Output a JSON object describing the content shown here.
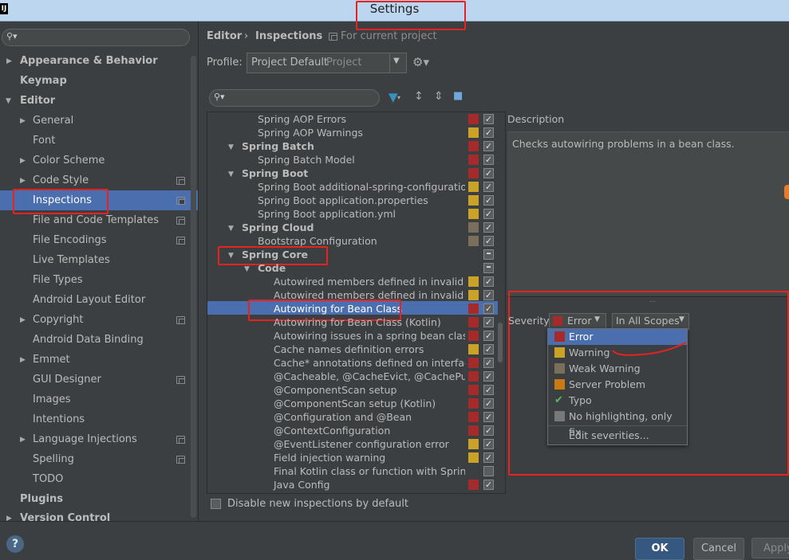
{
  "window": {
    "title": "Settings",
    "logo_text": "IJ"
  },
  "colors": {
    "error": "#a52a2a",
    "warning": "#c9a227",
    "weak_warning": "#7a6f5a",
    "server_problem": "#c87a14",
    "no_highlight": "#787878",
    "selection": "#4b6eaf",
    "annotation": "#e8221e"
  },
  "left_tree": {
    "items": [
      {
        "label": "Appearance & Behavior"
      },
      {
        "label": "Keymap"
      },
      {
        "label": "Editor"
      },
      {
        "label": "General"
      },
      {
        "label": "Font"
      },
      {
        "label": "Color Scheme"
      },
      {
        "label": "Code Style"
      },
      {
        "label": "Inspections"
      },
      {
        "label": "File and Code Templates"
      },
      {
        "label": "File Encodings"
      },
      {
        "label": "Live Templates"
      },
      {
        "label": "File Types"
      },
      {
        "label": "Android Layout Editor"
      },
      {
        "label": "Copyright"
      },
      {
        "label": "Android Data Binding"
      },
      {
        "label": "Emmet"
      },
      {
        "label": "GUI Designer"
      },
      {
        "label": "Images"
      },
      {
        "label": "Intentions"
      },
      {
        "label": "Language Injections"
      },
      {
        "label": "Spelling"
      },
      {
        "label": "TODO"
      },
      {
        "label": "Plugins"
      },
      {
        "label": "Version Control"
      }
    ]
  },
  "header": {
    "breadcrumb_editor": "Editor",
    "breadcrumb_sep": "›",
    "breadcrumb_inspections": "Inspections",
    "scope_note": "For current project",
    "profile_label": "Profile:",
    "profile_value": "Project Default",
    "profile_hint": "Project"
  },
  "inspections": {
    "rows": [
      {
        "label": "Spring AOP Errors"
      },
      {
        "label": "Spring AOP Warnings"
      },
      {
        "label": "Spring Batch"
      },
      {
        "label": "Spring Batch Model"
      },
      {
        "label": "Spring Boot"
      },
      {
        "label": "Spring Boot additional-spring-configuration-"
      },
      {
        "label": "Spring Boot application.properties"
      },
      {
        "label": "Spring Boot application.yml"
      },
      {
        "label": "Spring Cloud"
      },
      {
        "label": "Bootstrap Configuration"
      },
      {
        "label": "Spring Core"
      },
      {
        "label": "Code"
      },
      {
        "label": "Autowired members defined in invalid Sp"
      },
      {
        "label": "Autowired members defined in invalid Sp"
      },
      {
        "label": "Autowiring for Bean Class"
      },
      {
        "label": "Autowiring for Bean Class (Kotlin)"
      },
      {
        "label": "Autowiring issues in a spring bean class c"
      },
      {
        "label": "Cache names definition errors"
      },
      {
        "label": "Cache* annotations defined on interfaces,"
      },
      {
        "label": "@Cacheable, @CacheEvict, @CachePut, @"
      },
      {
        "label": "@ComponentScan setup"
      },
      {
        "label": "@ComponentScan setup (Kotlin)"
      },
      {
        "label": "@Configuration and @Bean"
      },
      {
        "label": "@ContextConfiguration"
      },
      {
        "label": "@EventListener configuration error"
      },
      {
        "label": "Field injection warning"
      },
      {
        "label": "Final Kotlin class or function with Spring a"
      },
      {
        "label": "Java Config"
      }
    ],
    "disable_new_label": "Disable new inspections by default"
  },
  "description": {
    "heading": "Description",
    "text": "Checks autowiring problems in a bean class."
  },
  "severity": {
    "label": "Severity:",
    "selected": "Error",
    "scope": "In All Scopes",
    "options": [
      {
        "label": "Error"
      },
      {
        "label": "Warning"
      },
      {
        "label": "Weak Warning"
      },
      {
        "label": "Server Problem"
      },
      {
        "label": "Typo"
      },
      {
        "label": "No highlighting, only fix"
      }
    ],
    "edit_label": "Edit severities..."
  },
  "footer": {
    "help_label": "?",
    "ok_label": "OK",
    "cancel_label": "Cancel",
    "apply_label": "Apply"
  }
}
